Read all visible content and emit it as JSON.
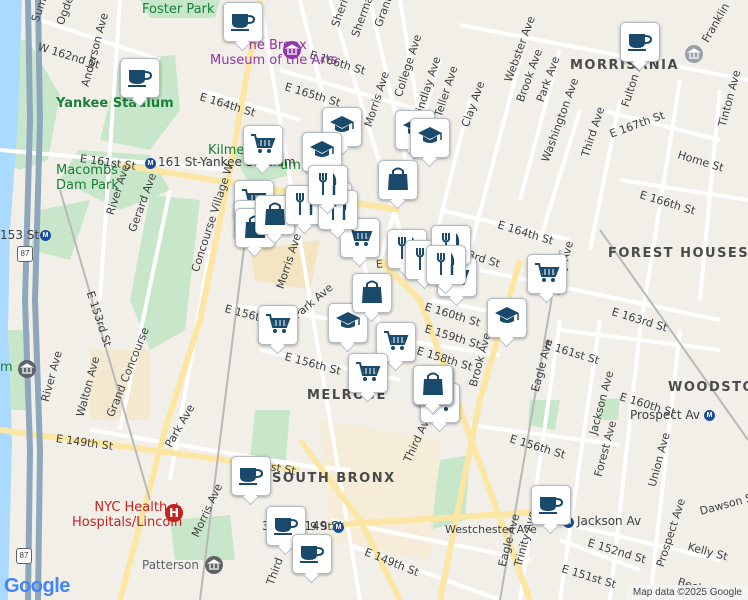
{
  "map": {
    "streets": [
      {
        "id": "w162",
        "text": "W 162nd St"
      },
      {
        "id": "ogden",
        "text": "Ogden"
      },
      {
        "id": "summit",
        "text": "Summit"
      },
      {
        "id": "anderson",
        "text": "Anderson Ave"
      },
      {
        "id": "e164w",
        "text": "E 164th St"
      },
      {
        "id": "e166",
        "text": "E 166th St"
      },
      {
        "id": "e165",
        "text": "E 165th St"
      },
      {
        "id": "sheridan",
        "text": "Sheridan Ave"
      },
      {
        "id": "sherman",
        "text": "Sherman Ave"
      },
      {
        "id": "grant",
        "text": "Grant Ave"
      },
      {
        "id": "morris_n",
        "text": "Morris Ave"
      },
      {
        "id": "college",
        "text": "College Ave"
      },
      {
        "id": "findlay",
        "text": "Findlay Ave"
      },
      {
        "id": "teller",
        "text": "Teller Ave"
      },
      {
        "id": "clay",
        "text": "Clay Ave"
      },
      {
        "id": "webster",
        "text": "Webster Ave"
      },
      {
        "id": "brook_n",
        "text": "Brook Ave"
      },
      {
        "id": "park_n",
        "text": "Park Ave"
      },
      {
        "id": "washington",
        "text": "Washington Ave"
      },
      {
        "id": "third_n",
        "text": "Third Ave"
      },
      {
        "id": "e167",
        "text": "E 167th St"
      },
      {
        "id": "franklin",
        "text": "Franklin"
      },
      {
        "id": "fulton",
        "text": "Fulton Ave"
      },
      {
        "id": "home",
        "text": "Home St"
      },
      {
        "id": "tinton",
        "text": "Tinton Ave"
      },
      {
        "id": "e166e",
        "text": "E 166th St"
      },
      {
        "id": "e161w",
        "text": "E 161st St"
      },
      {
        "id": "river_n",
        "text": "River Ave"
      },
      {
        "id": "gerard",
        "text": "Gerard Ave"
      },
      {
        "id": "concourse_v",
        "text": "Concourse Village W"
      },
      {
        "id": "e156",
        "text": "E 156th St"
      },
      {
        "id": "morris_s",
        "text": "Morris Ave"
      },
      {
        "id": "park_m",
        "text": "Park Ave"
      },
      {
        "id": "e156b",
        "text": "E 156th St"
      },
      {
        "id": "e153",
        "text": "E 153rd St"
      },
      {
        "id": "river_s",
        "text": "River Ave"
      },
      {
        "id": "walton",
        "text": "Walton Ave"
      },
      {
        "id": "grand_concourse",
        "text": "Grand Concourse"
      },
      {
        "id": "e149w",
        "text": "E 149th St"
      },
      {
        "id": "park_s",
        "text": "Park Ave"
      },
      {
        "id": "e151",
        "text": "E 151st St"
      },
      {
        "id": "morris_sw",
        "text": "Morris Ave"
      },
      {
        "id": "e164",
        "text": "E 164th St"
      },
      {
        "id": "e163a",
        "text": "3rd St"
      },
      {
        "id": "e161c",
        "text": "E 161st"
      },
      {
        "id": "e160",
        "text": "E 160th St"
      },
      {
        "id": "e159",
        "text": "E 159th St"
      },
      {
        "id": "e158",
        "text": "E 158th St"
      },
      {
        "id": "e163",
        "text": "E 163rd St"
      },
      {
        "id": "e161e",
        "text": "E 161st St"
      },
      {
        "id": "e160e",
        "text": "E 160th St"
      },
      {
        "id": "brook_s",
        "text": "Brook Ave"
      },
      {
        "id": "third_c",
        "text": "Third Ave"
      },
      {
        "id": "eagle",
        "text": "Eagle Ave"
      },
      {
        "id": "trinity",
        "text": "Trinity Ave"
      },
      {
        "id": "jackson",
        "text": "Jackson Ave"
      },
      {
        "id": "forest",
        "text": "Forest Ave"
      },
      {
        "id": "union",
        "text": "Union Ave"
      },
      {
        "id": "e156e",
        "text": "E 156th St"
      },
      {
        "id": "prospect_ave",
        "text": "Prospect Ave"
      },
      {
        "id": "dawson",
        "text": "Dawson St"
      },
      {
        "id": "kelly",
        "text": "Kelly St"
      },
      {
        "id": "e152",
        "text": "E 152nd St"
      },
      {
        "id": "westchester",
        "text": "Westchester Ave"
      },
      {
        "id": "e149",
        "text": "E 149th St"
      },
      {
        "id": "e151e",
        "text": "E 151st St"
      },
      {
        "id": "eagle_s",
        "text": "Eagle Ave"
      },
      {
        "id": "trinity_s",
        "text": "Trinity Ave"
      },
      {
        "id": "third_s",
        "text": "Third"
      },
      {
        "id": "beck",
        "text": "Beck St"
      },
      {
        "id": "e149c",
        "text": "9 St"
      }
    ],
    "neighborhoods": [
      {
        "id": "morrisania",
        "text": "MORRISANIA"
      },
      {
        "id": "forest_houses",
        "text": "FOREST HOUSES"
      },
      {
        "id": "woodstock",
        "text": "WOODSTOCK"
      },
      {
        "id": "melrose",
        "text": "MELROSE"
      },
      {
        "id": "south_bronx",
        "text": "SOUTH BRONX"
      }
    ],
    "places": [
      {
        "id": "foster_park",
        "text": "Foster Park",
        "kind": "park"
      },
      {
        "id": "yankee_stadium",
        "text": "Yankee Stadium",
        "kind": "park"
      },
      {
        "id": "macombs",
        "text": "Macombs\nDam Park",
        "kind": "park"
      },
      {
        "id": "bronx_museum",
        "text": "The Bronx\nMuseum of the Arts",
        "kind": "poi"
      },
      {
        "id": "joyce_kilmer",
        "text": "Joyce\nKilmer Park",
        "kind": "park"
      },
      {
        "id": "nyc_health",
        "text": "NYC Health +\nHospitals/Lincoln",
        "kind": "poi-red"
      },
      {
        "id": "patterson",
        "text": "Patterson",
        "kind": "poi-gray"
      },
      {
        "id": "stadium_partial",
        "text": "um",
        "kind": "park"
      },
      {
        "id": "left_m",
        "text": "m",
        "kind": "park"
      }
    ],
    "stations": [
      {
        "id": "s161",
        "text": "161 St-Yankee Stadium"
      },
      {
        "id": "s153",
        "text": "153 St"
      },
      {
        "id": "s149",
        "text": "3rd Av-149 St"
      },
      {
        "id": "prospect",
        "text": "Prospect Av"
      },
      {
        "id": "jackson_av",
        "text": "Jackson Av"
      }
    ],
    "highways": [
      {
        "id": "h87a",
        "text": "87"
      },
      {
        "id": "h87b",
        "text": "87"
      }
    ],
    "colors": {
      "background": "#f2efe9",
      "road": "#ffffff",
      "road_major": "#fbe7a3",
      "park": "#c8e6c9",
      "water": "#aadaff",
      "highway": "#8ea7bd",
      "rail": "#b8b8b8",
      "pin_icon": "#1a4a6b"
    },
    "pins": [
      {
        "type": "cafe-icon"
      },
      {
        "type": "cafe-icon"
      },
      {
        "type": "cafe-icon"
      },
      {
        "type": "school-icon"
      },
      {
        "type": "school-icon"
      },
      {
        "type": "school-icon"
      },
      {
        "type": "grocery-icon"
      },
      {
        "type": "shopping-bag-icon"
      },
      {
        "type": "restaurant-icon"
      }
    ],
    "attribution": "Map data ©2025 Google",
    "logo": "Google"
  }
}
